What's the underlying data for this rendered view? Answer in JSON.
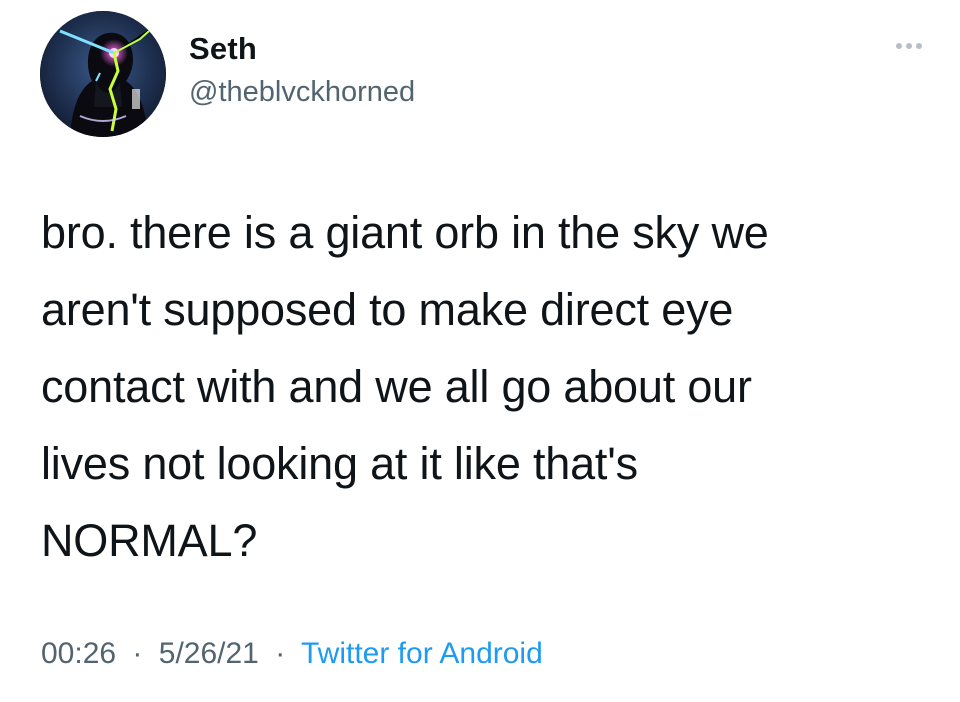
{
  "tweet": {
    "author": {
      "display_name": "Seth",
      "handle": "@theblvckhorned",
      "avatar": "profile-photo"
    },
    "more_icon": "ellipsis-icon",
    "text": "bro. there is a giant orb in the sky we\naren't supposed to make direct eye\ncontact with and we all go about our\nlives not looking at it like that's\nNORMAL?",
    "meta": {
      "time": "00:26",
      "separator": "·",
      "date": "5/26/21",
      "source": "Twitter for Android"
    }
  },
  "colors": {
    "text": "#0f1419",
    "secondary": "#536471",
    "link": "#1d9bf0",
    "more_dots": "#b6bfc7"
  }
}
